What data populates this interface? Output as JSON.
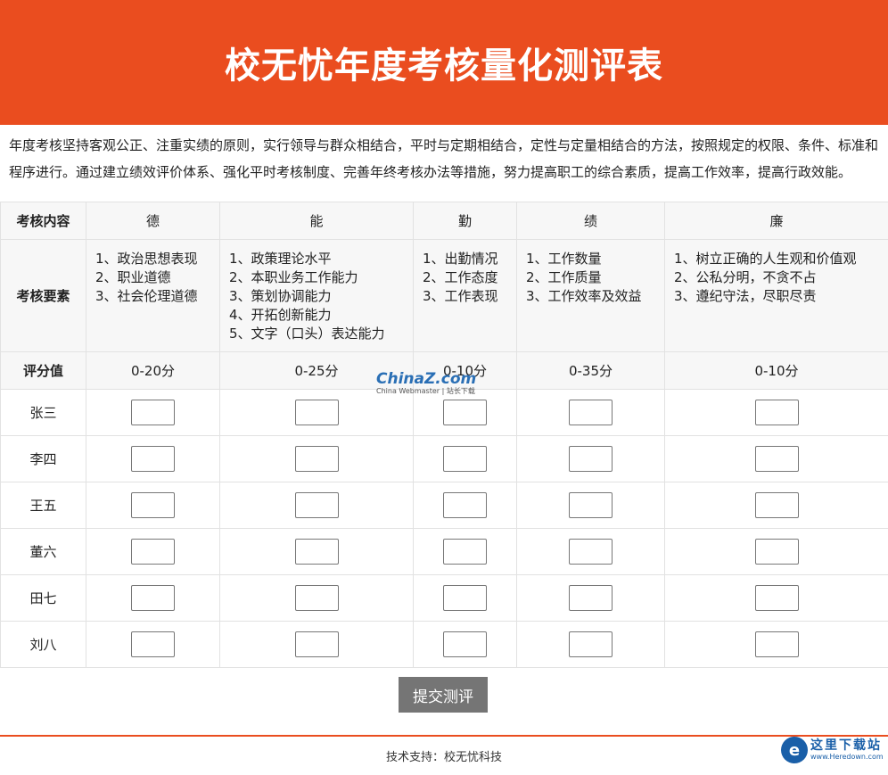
{
  "page_title": "校无忧年度考核量化测评表",
  "intro": "年度考核坚持客观公正、注重实绩的原则，实行领导与群众相结合，平时与定期相结合，定性与定量相结合的方法，按照规定的权限、条件、标准和程序进行。通过建立绩效评价体系、强化平时考核制度、完善年终考核办法等措施，努力提高职工的综合素质，提高工作效率，提高行政效能。",
  "table": {
    "row_labels": {
      "content": "考核内容",
      "requirements": "考核要素",
      "score": "评分值"
    },
    "columns": [
      {
        "name": "德",
        "requirements": "1、政治思想表现\n2、职业道德\n3、社会伦理道德",
        "score": "0-20分"
      },
      {
        "name": "能",
        "requirements": "1、政策理论水平\n2、本职业务工作能力\n3、策划协调能力\n4、开拓创新能力\n5、文字（口头）表达能力",
        "score": "0-25分"
      },
      {
        "name": "勤",
        "requirements": "1、出勤情况\n2、工作态度\n3、工作表现",
        "score": "0-10分"
      },
      {
        "name": "绩",
        "requirements": "1、工作数量\n2、工作质量\n3、工作效率及效益",
        "score": "0-35分"
      },
      {
        "name": "廉",
        "requirements": "1、树立正确的人生观和价值观\n2、公私分明，不贪不占\n3、遵纪守法，尽职尽责",
        "score": "0-10分"
      }
    ],
    "people": [
      "张三",
      "李四",
      "王五",
      "董六",
      "田七",
      "刘八"
    ]
  },
  "submit_label": "提交测评",
  "footer": "技术支持：校无忧科技",
  "watermarks": {
    "china_z": {
      "main": "ChinaZ.com",
      "sub": "China Webmaster | 站长下载"
    },
    "heredown": {
      "main": "这里下载站",
      "sub": "www.Heredown.com"
    }
  },
  "colors": {
    "brand": "#ea4d1f",
    "button": "#757575",
    "watermark_blue": "#1a5fa8"
  }
}
